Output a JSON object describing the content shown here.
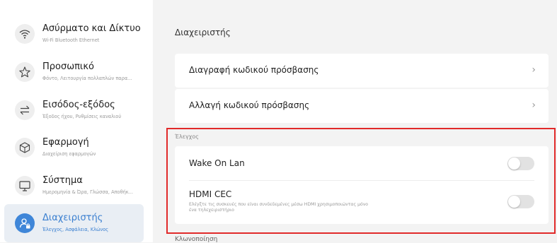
{
  "sidebar": {
    "items": [
      {
        "title": "Ασύρματο και Δίκτυο",
        "subtitle": "Wi-Fi Bluetooth Ethernet",
        "icon": "wifi-icon"
      },
      {
        "title": "Προσωπικό",
        "subtitle": "Φόντο, Λειτουργία πολλαπλών παρα...",
        "icon": "star-icon"
      },
      {
        "title": "Εισόδος-εξόδος",
        "subtitle": "Έξοδος ήχου, Ρυθμίσεις καναλιού",
        "icon": "arrows-swap-icon"
      },
      {
        "title": "Εφαρμογή",
        "subtitle": "Διαχείριση εφαρμογών",
        "icon": "cube-icon"
      },
      {
        "title": "Σύστημα",
        "subtitle": "Ημερομηνία & Ώρα, Γλώσσα, Αποθήκ...",
        "icon": "monitor-icon"
      },
      {
        "title": "Διαχειριστής",
        "subtitle": "Έλεγχος, Ασφάλεια, Κλώνος",
        "icon": "admin-user-lock-icon"
      }
    ]
  },
  "main": {
    "heading": "Διαχειριστής",
    "cards": [
      {
        "label": "Διαγραφή κωδικού πρόσβασης",
        "chevron": "›"
      },
      {
        "label": "Αλλαγή κωδικού πρόσβασης",
        "chevron": "›"
      }
    ],
    "control_section": {
      "label": "Έλεγχος",
      "rows": [
        {
          "label": "Wake On Lan",
          "toggle_on": false
        },
        {
          "label": "HDMI CEC",
          "description": "Ελέγξτε τις συσκευές που είναι συνδεδεμένες μέσω HDMI χρησιμοποιώντας μόνο ένα τηλεχειριστήριο",
          "toggle_on": false
        }
      ]
    },
    "next_section_label": "Κλωνοποίηση"
  },
  "colors": {
    "accent": "#3f86d8",
    "highlight_border": "#e12a2a",
    "background": "#f3f3f3"
  }
}
